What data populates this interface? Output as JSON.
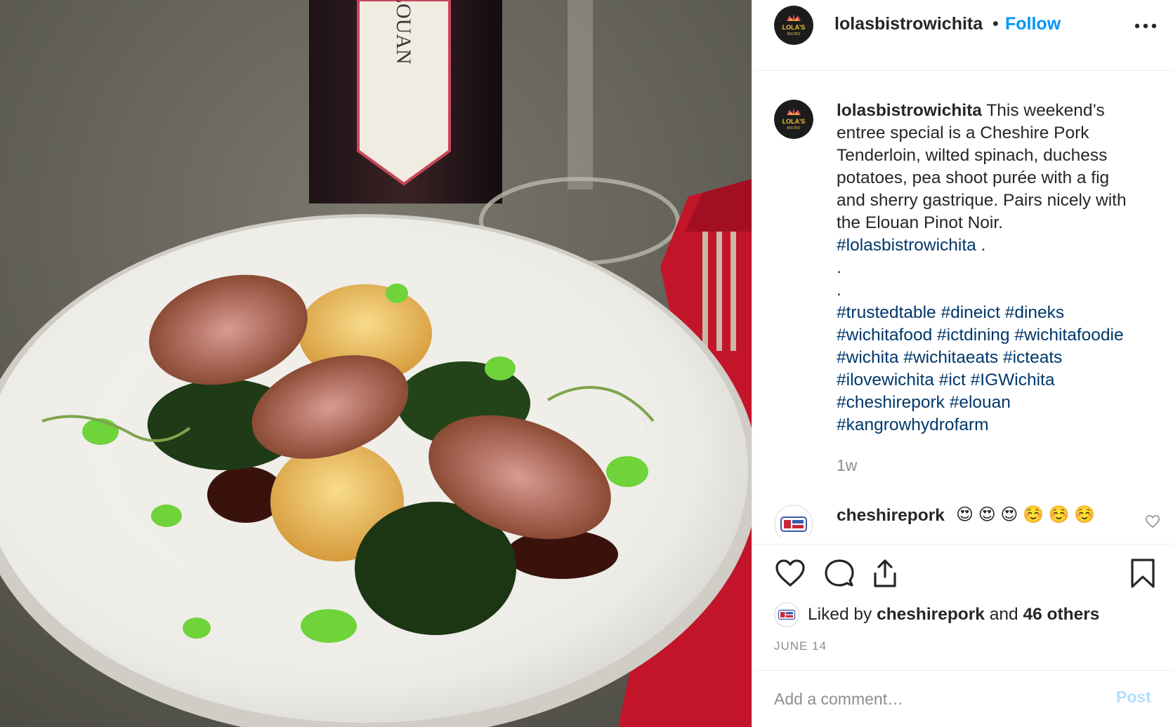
{
  "header": {
    "username": "lolasbistrowichita",
    "separator": "•",
    "follow_label": "Follow",
    "more_icon": "more-horizontal-icon"
  },
  "photo": {
    "label_text": "ELOUAN"
  },
  "caption": {
    "username": "lolasbistrowichita",
    "text_lines": [
      "This weekend’s",
      "entree special is a Cheshire Pork",
      "Tenderloin, wilted spinach, duchess",
      "potatoes, pea shoot purée with a fig",
      "and sherry gastrique. Pairs nicely with",
      "the Elouan Pinot Noir."
    ],
    "inline_tag": "#lolasbistrowichita",
    "after_tag": " .",
    "dot_lines": [
      ".",
      "."
    ],
    "hashtag_lines": [
      "#trustedtable #dineict #dineks",
      "#wichitafood #ictdining #wichitafoodie",
      "#wichita #wichitaeats #icteats",
      "#ilovewichita #ict #IGWichita",
      "#cheshirepork #elouan",
      "#kangrowhydrofarm"
    ],
    "time_ago": "1w"
  },
  "comment": {
    "username": "cheshirepork",
    "emojis": "😍 😍 😍 ☺️ ☺️ ☺️"
  },
  "actions": {
    "icons": [
      "heart-icon",
      "comment-icon",
      "share-icon",
      "bookmark-icon"
    ],
    "likes_prefix": "Liked by ",
    "likes_user": "cheshirepork",
    "likes_mid": " and ",
    "likes_count": "46 others",
    "date": "JUNE 14"
  },
  "comment_box": {
    "placeholder": "Add a comment…",
    "post_label": "Post"
  },
  "colors": {
    "accent": "#0095f6",
    "hashtag": "#00376b",
    "muted": "#8e8e8e",
    "post_disabled": "#b2dffc"
  }
}
